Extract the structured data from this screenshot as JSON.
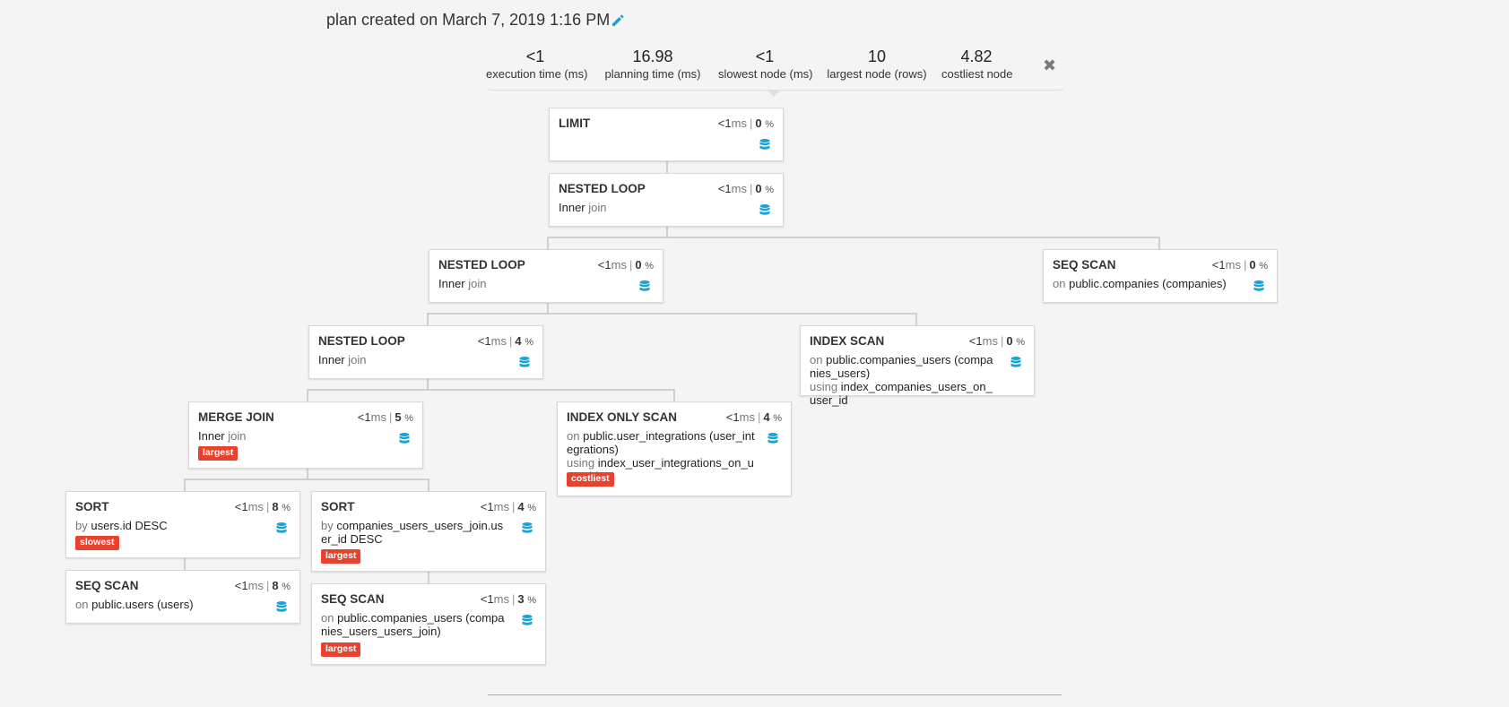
{
  "plan": {
    "title": "plan created on March 7, 2019 1:16 PM"
  },
  "stats": [
    {
      "value": "<1",
      "label": "execution time (ms)"
    },
    {
      "value": "16.98",
      "label": "planning time (ms)"
    },
    {
      "value": "<1",
      "label": "slowest node (ms)"
    },
    {
      "value": "10",
      "label": "largest node (rows)"
    },
    {
      "value": "4.82",
      "label": "costliest node"
    }
  ],
  "close_glyph": "✖",
  "colors": {
    "accent": "#1aa3d6",
    "tag": "#e8412c"
  },
  "icons": {
    "edit": "pencil-icon",
    "database": "database-icon",
    "close": "close-icon"
  },
  "nodes": [
    {
      "name": "LIMIT",
      "time": "<1",
      "unit": "ms",
      "pct": "0",
      "pct_unit": "%"
    },
    {
      "name": "NESTED LOOP",
      "time": "<1",
      "unit": "ms",
      "pct": "0",
      "pct_unit": "%",
      "desc_a": "Inner",
      "desc_b": "join"
    },
    {
      "name": "NESTED LOOP",
      "time": "<1",
      "unit": "ms",
      "pct": "0",
      "pct_unit": "%",
      "desc_a": "Inner",
      "desc_b": "join"
    },
    {
      "name": "SEQ SCAN",
      "time": "<1",
      "unit": "ms",
      "pct": "0",
      "pct_unit": "%",
      "desc_a": "on",
      "desc_b": "public.companies (companies)"
    },
    {
      "name": "NESTED LOOP",
      "time": "<1",
      "unit": "ms",
      "pct": "4",
      "pct_unit": "%",
      "desc_a": "Inner",
      "desc_b": "join"
    },
    {
      "name": "INDEX SCAN",
      "time": "<1",
      "unit": "ms",
      "pct": "0",
      "pct_unit": "%",
      "desc_a": "on",
      "desc_b": "public.companies_users (companies_users)",
      "using_kw": "using",
      "using_val": "index_companies_users_on_user_id"
    },
    {
      "name": "MERGE JOIN",
      "time": "<1",
      "unit": "ms",
      "pct": "5",
      "pct_unit": "%",
      "desc_a": "Inner",
      "desc_b": "join",
      "tag": "largest"
    },
    {
      "name": "INDEX ONLY SCAN",
      "time": "<1",
      "unit": "ms",
      "pct": "4",
      "pct_unit": "%",
      "desc_a": "on",
      "desc_b": "public.user_integrations (user_integrations)",
      "using_kw": "using",
      "using_val": "index_user_integrations_on_user_id",
      "tag": "costliest"
    },
    {
      "name": "SORT",
      "time": "<1",
      "unit": "ms",
      "pct": "8",
      "pct_unit": "%",
      "desc_a": "by",
      "desc_b": "users.id DESC",
      "tag": "slowest"
    },
    {
      "name": "SORT",
      "time": "<1",
      "unit": "ms",
      "pct": "4",
      "pct_unit": "%",
      "desc_a": "by",
      "desc_b": "companies_users_users_join.user_id DESC",
      "tag": "largest"
    },
    {
      "name": "SEQ SCAN",
      "time": "<1",
      "unit": "ms",
      "pct": "8",
      "pct_unit": "%",
      "desc_a": "on",
      "desc_b": "public.users (users)"
    },
    {
      "name": "SEQ SCAN",
      "time": "<1",
      "unit": "ms",
      "pct": "3",
      "pct_unit": "%",
      "desc_a": "on",
      "desc_b": "public.companies_users (companies_users_users_join)",
      "tag": "largest"
    }
  ]
}
